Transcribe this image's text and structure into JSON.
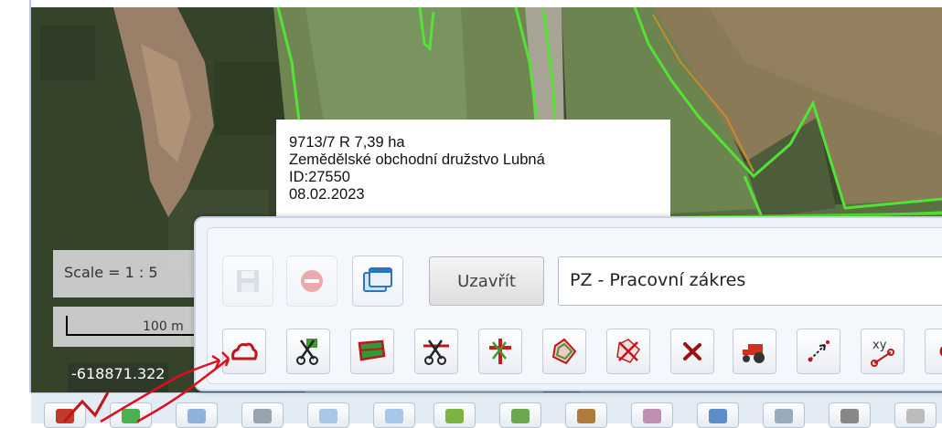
{
  "map": {
    "tooltip": {
      "line1": "9713/7 R 7,39 ha",
      "line2": "Zemědělské obchodní družstvo Lubná",
      "line3": "ID:27550",
      "line4": "08.02.2023"
    },
    "scale_text": "Scale = 1 : 5",
    "scale_bar_label": "100 m",
    "coordinate": "-618871.322",
    "colors": {
      "parcel_outline": "#53e334",
      "selected_outline": "#c98a2a"
    }
  },
  "edit_panel": {
    "close_label": "Uzavřít",
    "layer_select_value": "PZ - Pracovní zákres",
    "top_buttons": [
      {
        "icon": "save-icon",
        "enabled": false
      },
      {
        "icon": "delete-icon",
        "enabled": false
      },
      {
        "icon": "windows-icon",
        "enabled": true
      }
    ],
    "tools": [
      {
        "icon": "red-cloud-draw-icon"
      },
      {
        "icon": "scissors-cut-icon"
      },
      {
        "icon": "cut-polygon-icon"
      },
      {
        "icon": "scissors-line-icon"
      },
      {
        "icon": "scissors-red-icon"
      },
      {
        "icon": "polygon-outline-icon"
      },
      {
        "icon": "scissors-cross-icon"
      },
      {
        "icon": "red-x-icon"
      },
      {
        "icon": "tractor-icon"
      },
      {
        "icon": "arrow-point-icon"
      },
      {
        "icon": "xy-icon",
        "label": "xy"
      },
      {
        "icon": "more-tool-icon"
      }
    ]
  },
  "bottom_toolbar": {
    "items": [
      "chart-icon",
      "arrow-icon",
      "window-icon",
      "zoom-icon",
      "zoom-in-icon",
      "zoom-out-icon",
      "layers-icon",
      "puzzle-icon",
      "pencil-icon",
      "image-icon",
      "print-icon",
      "note-icon",
      "gear-icon",
      "doc-icon"
    ]
  }
}
